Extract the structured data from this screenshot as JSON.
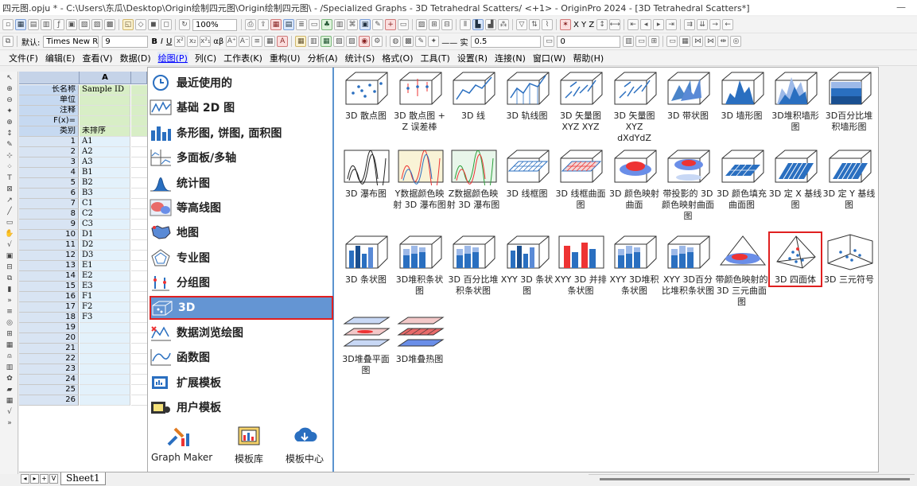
{
  "window": {
    "title": "四元图.opju * - C:\\Users\\东瓜\\Desktop\\Origin绘制四元图\\Origin绘制四元图\\ - /Specialized Graphs - 3D Tetrahedral Scatters/ <+1> - OriginPro 2024 - [3D Tetrahedral Scatters*]",
    "minimize": "—"
  },
  "toolbar1": {
    "zoom": "100%",
    "axis_labels": "X Y Z"
  },
  "toolbar2": {
    "font_prefix": "默认: ",
    "font_name": "Times New R",
    "font_size": "9",
    "bold": "B",
    "italic": "I",
    "underline": "U",
    "greek": "αβ",
    "line_style": "实",
    "line_width": "0.5",
    "value_zero": "0"
  },
  "menu": [
    "文件(F)",
    "编辑(E)",
    "查看(V)",
    "数据(D)",
    "绘图(P)",
    "列(C)",
    "工作表(K)",
    "重构(U)",
    "分析(A)",
    "统计(S)",
    "格式(O)",
    "工具(T)",
    "设置(R)",
    "连接(N)",
    "窗口(W)",
    "帮助(H)"
  ],
  "menu_active_index": 4,
  "sheet": {
    "column_header": "A",
    "meta_rows": [
      {
        "label": "长名称",
        "value": "Sample ID"
      },
      {
        "label": "单位",
        "value": ""
      },
      {
        "label": "注释",
        "value": ""
      },
      {
        "label": "F(x)=",
        "value": ""
      },
      {
        "label": "类别",
        "value": "未排序"
      }
    ],
    "rows": [
      {
        "n": "1",
        "v": "A1"
      },
      {
        "n": "2",
        "v": "A2"
      },
      {
        "n": "3",
        "v": "A3"
      },
      {
        "n": "4",
        "v": "B1"
      },
      {
        "n": "5",
        "v": "B2"
      },
      {
        "n": "6",
        "v": "B3"
      },
      {
        "n": "7",
        "v": "C1"
      },
      {
        "n": "8",
        "v": "C2"
      },
      {
        "n": "9",
        "v": "C3"
      },
      {
        "n": "10",
        "v": "D1"
      },
      {
        "n": "11",
        "v": "D2"
      },
      {
        "n": "12",
        "v": "D3"
      },
      {
        "n": "13",
        "v": "E1"
      },
      {
        "n": "14",
        "v": "E2"
      },
      {
        "n": "15",
        "v": "E3"
      },
      {
        "n": "16",
        "v": "F1"
      },
      {
        "n": "17",
        "v": "F2"
      },
      {
        "n": "18",
        "v": "F3"
      },
      {
        "n": "19",
        "v": ""
      },
      {
        "n": "20",
        "v": ""
      },
      {
        "n": "21",
        "v": ""
      },
      {
        "n": "22",
        "v": ""
      },
      {
        "n": "23",
        "v": ""
      },
      {
        "n": "24",
        "v": ""
      },
      {
        "n": "25",
        "v": ""
      },
      {
        "n": "26",
        "v": ""
      }
    ],
    "tab_nav": [
      "◂",
      "▸",
      "+",
      "V"
    ],
    "tab": "Sheet1"
  },
  "categories": [
    {
      "label": "最近使用的",
      "icon": "clock-icon"
    },
    {
      "label": "基础 2D 图",
      "icon": "line-chart-icon"
    },
    {
      "label": "条形图, 饼图, 面积图",
      "icon": "bar-chart-icon"
    },
    {
      "label": "多面板/多轴",
      "icon": "multi-panel-icon"
    },
    {
      "label": "统计图",
      "icon": "histogram-icon"
    },
    {
      "label": "等高线图",
      "icon": "contour-icon"
    },
    {
      "label": "地图",
      "icon": "map-icon"
    },
    {
      "label": "专业图",
      "icon": "pentagon-icon"
    },
    {
      "label": "分组图",
      "icon": "grouped-icon"
    },
    {
      "label": "3D",
      "icon": "3d-icon"
    },
    {
      "label": "数据浏览绘图",
      "icon": "data-explore-icon"
    },
    {
      "label": "函数图",
      "icon": "function-icon"
    },
    {
      "label": "扩展模板",
      "icon": "extend-template-icon"
    },
    {
      "label": "用户模板",
      "icon": "user-template-icon"
    }
  ],
  "selected_category_index": 9,
  "bottom_tools": [
    {
      "label": "Graph Maker",
      "icon": "graph-maker-icon"
    },
    {
      "label": "模板库",
      "icon": "template-library-icon"
    },
    {
      "label": "模板中心",
      "icon": "cloud-download-icon"
    }
  ],
  "graphs": [
    {
      "label": "3D 散点图",
      "icon": "3d-scatter-icon"
    },
    {
      "label": "3D 散点图 + Z 误差棒",
      "icon": "3d-scatter-errorbar-icon"
    },
    {
      "label": "3D 线",
      "icon": "3d-line-icon"
    },
    {
      "label": "3D 轨线图",
      "icon": "3d-trajectory-icon"
    },
    {
      "label": "3D 矢量图 XYZ XYZ",
      "icon": "3d-vector-icon"
    },
    {
      "label": "3D 矢量图 XYZ dXdYdZ",
      "icon": "3d-vector-delta-icon"
    },
    {
      "label": "3D 带状图",
      "icon": "3d-ribbon-icon"
    },
    {
      "label": "3D 墙形图",
      "icon": "3d-wall-icon"
    },
    {
      "label": "3D堆积墙形图",
      "icon": "3d-stacked-wall-icon"
    },
    {
      "label": "3D百分比堆积墙形图",
      "icon": "3d-percent-wall-icon"
    },
    {
      "label": "3D 瀑布图",
      "icon": "3d-waterfall-icon"
    },
    {
      "label": "Y数据颜色映射 3D 瀑布图",
      "icon": "y-colormap-waterfall-icon"
    },
    {
      "label": "Z数据颜色映射 3D 瀑布图",
      "icon": "z-colormap-waterfall-icon"
    },
    {
      "label": "3D 线框图",
      "icon": "3d-wireframe-icon"
    },
    {
      "label": "3D 线框曲面图",
      "icon": "3d-wireframe-surface-icon"
    },
    {
      "label": "3D 颜色映射曲面",
      "icon": "3d-colormap-surface-icon"
    },
    {
      "label": "带投影的 3D 颜色映射曲面图",
      "icon": "3d-projection-surface-icon"
    },
    {
      "label": "3D 颜色填充曲面图",
      "icon": "3d-colorfill-surface-icon"
    },
    {
      "label": "3D 定 X 基线图",
      "icon": "3d-x-baseline-icon"
    },
    {
      "label": "3D 定 Y 基线图",
      "icon": "3d-y-baseline-icon"
    },
    {
      "label": "3D 条状图",
      "icon": "3d-bar-icon"
    },
    {
      "label": "3D堆积条状图",
      "icon": "3d-stacked-bar-icon"
    },
    {
      "label": "3D 百分比堆积条状图",
      "icon": "3d-percent-bar-icon"
    },
    {
      "label": "XYY 3D 条状图",
      "icon": "xyy-3d-bar-icon"
    },
    {
      "label": "XYY 3D 并排条状图",
      "icon": "xyy-3d-side-bar-icon"
    },
    {
      "label": "XYY 3D堆积条状图",
      "icon": "xyy-3d-stacked-bar-icon"
    },
    {
      "label": "XYY 3D百分比堆积条状图",
      "icon": "xyy-3d-percent-bar-icon"
    },
    {
      "label": "带颜色映射的 3D 三元曲面图",
      "icon": "3d-ternary-surface-icon"
    },
    {
      "label": "3D 四面体",
      "icon": "3d-tetrahedron-icon"
    },
    {
      "label": "3D 三元符号",
      "icon": "3d-ternary-symbol-icon"
    },
    {
      "label": "3D堆叠平面图",
      "icon": "3d-stacked-plane-icon"
    },
    {
      "label": "3D堆叠热图",
      "icon": "3d-stacked-heatmap-icon"
    }
  ],
  "selected_graph_index": 28,
  "colors": {
    "accent_blue": "#6495d3",
    "selection_red": "#e02020",
    "sheet_header": "#c6d9f1"
  }
}
